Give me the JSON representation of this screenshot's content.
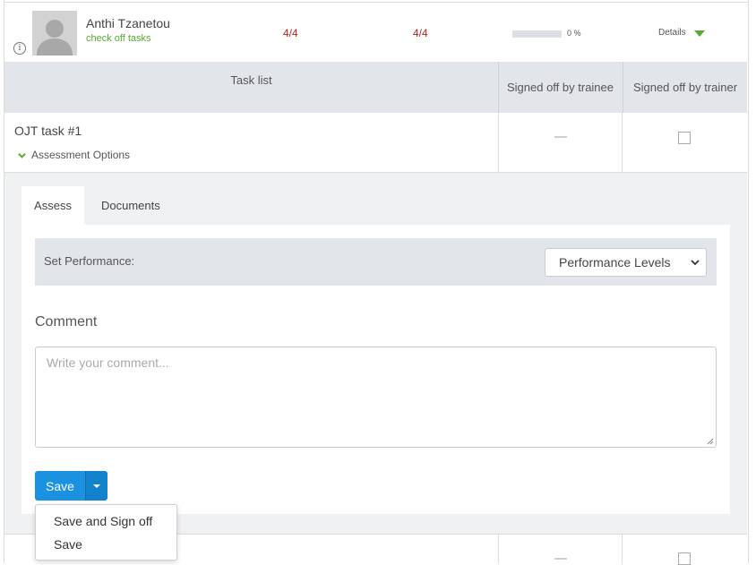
{
  "trainee": {
    "name": "Anthi Tzanetou",
    "link": "check off tasks",
    "count_a": "4/4",
    "count_b": "4/4",
    "progress": 0,
    "progress_label": "0 %",
    "details_label": "Details"
  },
  "task_table": {
    "headers": {
      "task_list": "Task list",
      "signed_trainee": "Signed off by trainee",
      "signed_trainer": "Signed off by trainer"
    },
    "rows": [
      {
        "title": "OJT task #1",
        "options_label": "Assessment Options"
      }
    ]
  },
  "panel": {
    "tabs": [
      {
        "label": "Assess",
        "active": true
      },
      {
        "label": "Documents",
        "active": false
      }
    ],
    "performance": {
      "label": "Set Performance:",
      "selected": "Performance Levels"
    },
    "comment": {
      "label": "Comment",
      "placeholder": "Write your comment..."
    },
    "save_label": "Save"
  },
  "dropdown_menu": {
    "items": [
      "Save and Sign off",
      "Save"
    ]
  },
  "colors": {
    "accent_blue": "#1a92e0",
    "green": "#5aa832",
    "count_red": "#b22222",
    "header_bg": "#e2e5e9"
  }
}
